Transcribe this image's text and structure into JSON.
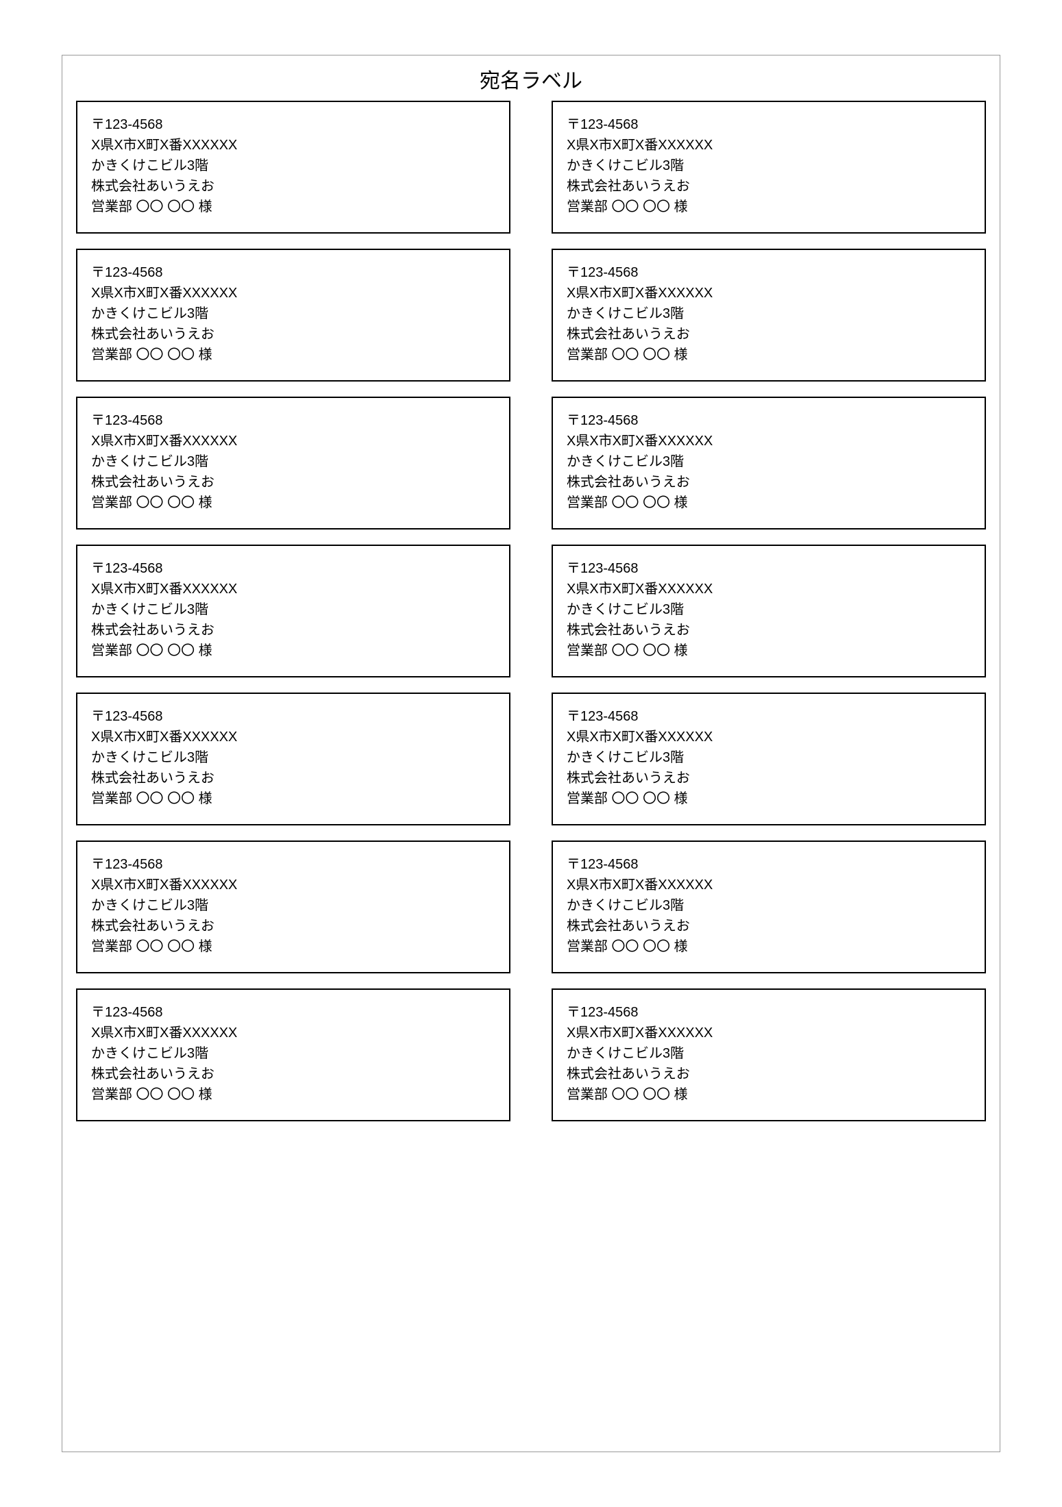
{
  "title": "宛名ラベル",
  "labels": [
    {
      "postal": "〒123-4568",
      "address": "X県X市X町X番XXXXXX",
      "building": "かきくけこビル3階",
      "company": "株式会社あいうえお",
      "recipient": "営業部 〇〇 〇〇 様"
    },
    {
      "postal": "〒123-4568",
      "address": "X県X市X町X番XXXXXX",
      "building": "かきくけこビル3階",
      "company": "株式会社あいうえお",
      "recipient": "営業部 〇〇 〇〇 様"
    },
    {
      "postal": "〒123-4568",
      "address": "X県X市X町X番XXXXXX",
      "building": "かきくけこビル3階",
      "company": "株式会社あいうえお",
      "recipient": "営業部 〇〇 〇〇 様"
    },
    {
      "postal": "〒123-4568",
      "address": "X県X市X町X番XXXXXX",
      "building": "かきくけこビル3階",
      "company": "株式会社あいうえお",
      "recipient": "営業部 〇〇 〇〇 様"
    },
    {
      "postal": "〒123-4568",
      "address": "X県X市X町X番XXXXXX",
      "building": "かきくけこビル3階",
      "company": "株式会社あいうえお",
      "recipient": "営業部 〇〇 〇〇 様"
    },
    {
      "postal": "〒123-4568",
      "address": "X県X市X町X番XXXXXX",
      "building": "かきくけこビル3階",
      "company": "株式会社あいうえお",
      "recipient": "営業部 〇〇 〇〇 様"
    },
    {
      "postal": "〒123-4568",
      "address": "X県X市X町X番XXXXXX",
      "building": "かきくけこビル3階",
      "company": "株式会社あいうえお",
      "recipient": "営業部 〇〇 〇〇 様"
    },
    {
      "postal": "〒123-4568",
      "address": "X県X市X町X番XXXXXX",
      "building": "かきくけこビル3階",
      "company": "株式会社あいうえお",
      "recipient": "営業部 〇〇 〇〇 様"
    },
    {
      "postal": "〒123-4568",
      "address": "X県X市X町X番XXXXXX",
      "building": "かきくけこビル3階",
      "company": "株式会社あいうえお",
      "recipient": "営業部 〇〇 〇〇 様"
    },
    {
      "postal": "〒123-4568",
      "address": "X県X市X町X番XXXXXX",
      "building": "かきくけこビル3階",
      "company": "株式会社あいうえお",
      "recipient": "営業部 〇〇 〇〇 様"
    },
    {
      "postal": "〒123-4568",
      "address": "X県X市X町X番XXXXXX",
      "building": "かきくけこビル3階",
      "company": "株式会社あいうえお",
      "recipient": "営業部 〇〇 〇〇 様"
    },
    {
      "postal": "〒123-4568",
      "address": "X県X市X町X番XXXXXX",
      "building": "かきくけこビル3階",
      "company": "株式会社あいうえお",
      "recipient": "営業部 〇〇 〇〇 様"
    },
    {
      "postal": "〒123-4568",
      "address": "X県X市X町X番XXXXXX",
      "building": "かきくけこビル3階",
      "company": "株式会社あいうえお",
      "recipient": "営業部 〇〇 〇〇 様"
    },
    {
      "postal": "〒123-4568",
      "address": "X県X市X町X番XXXXXX",
      "building": "かきくけこビル3階",
      "company": "株式会社あいうえお",
      "recipient": "営業部 〇〇 〇〇 様"
    }
  ]
}
